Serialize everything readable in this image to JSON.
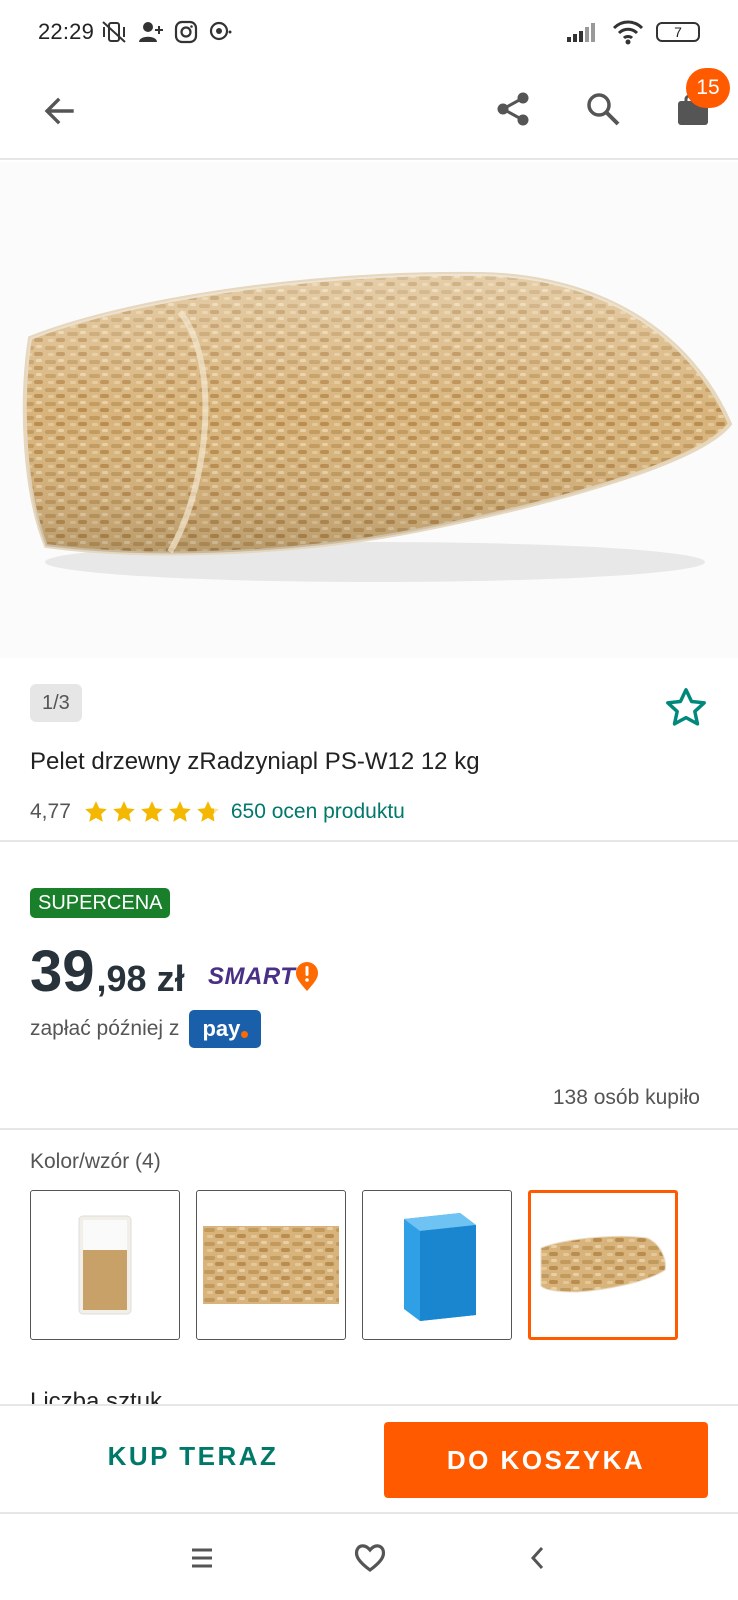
{
  "status_bar": {
    "time": "22:29",
    "battery": "7"
  },
  "app_bar": {
    "cart_count": "15"
  },
  "product": {
    "image_counter": "1/3",
    "title": "Pelet drzewny zRadzyniapl PS-W12 12 kg",
    "rating": "4,77",
    "stars_rating": 4.77,
    "rating_count": "650 ocen produktu",
    "badge": "SUPERCENA",
    "price_int": "39",
    "price_frac": ",98",
    "currency": "zł",
    "smart_label": "SMART",
    "pay_later_text": "zapłać później z",
    "pay_logo": "pay",
    "bought_count": "138 osób kupiło"
  },
  "variants": {
    "label": "Kolor/wzór (4)",
    "selected_index": 3
  },
  "next_section_label": "Liczba sztuk",
  "actions": {
    "buy_now": "KUP TERAZ",
    "add_to_cart": "DO KOSZYKA"
  },
  "colors": {
    "accent_orange": "#ff5a00",
    "teal": "#00796b",
    "supercena_green": "#1a7f2b",
    "smart_purple": "#4a2f86",
    "pay_blue": "#1a5faa",
    "star_yellow": "#f5b800"
  }
}
